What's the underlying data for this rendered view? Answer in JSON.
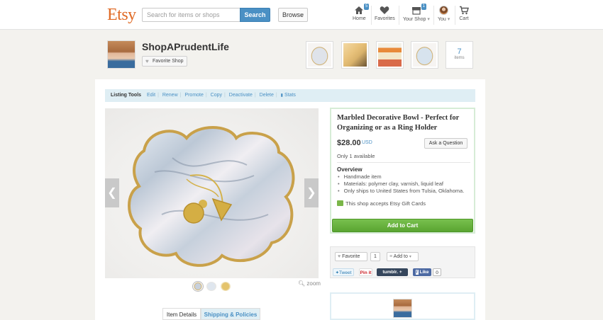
{
  "header": {
    "logo": "Etsy",
    "search_placeholder": "Search for items or shops",
    "search_button": "Search",
    "browse": "Browse",
    "nav": {
      "home": "Home",
      "home_badge": "5",
      "favorites": "Favorites",
      "your_shop": "Your Shop",
      "your_shop_badge": "1",
      "you": "You",
      "cart": "Cart"
    }
  },
  "shop": {
    "name": "ShopAPrudentLife",
    "favorite_button": "Favorite Shop",
    "items_count": "7",
    "items_label": "items"
  },
  "listing_tools": {
    "label": "Listing Tools",
    "links": [
      "Edit",
      "Renew",
      "Promote",
      "Copy",
      "Deactivate",
      "Delete",
      "Stats"
    ]
  },
  "item": {
    "title": "Marbled Decorative Bowl - Perfect for Organizing or as a Ring Holder",
    "price": "$28.00",
    "currency": "USD",
    "ask_button": "Ask a Question",
    "availability": "Only 1 available",
    "overview_title": "Overview",
    "overview": [
      "Handmade item",
      "Materials: polymer clay, varnish, liquid leaf",
      "Only ships to United States from Tulsia, Oklahoma."
    ],
    "gift_cards": "This shop accepts Etsy Gift Cards",
    "add_to_cart": "Add to Cart",
    "zoom": "zoom"
  },
  "actions": {
    "favorite": "Favorite",
    "favorite_count": "1",
    "add_to": "Add to",
    "tweet": "Tweet",
    "pin": "Pin it",
    "tumblr": "tumblr.",
    "like": "Like",
    "like_count": "0"
  },
  "tabs": [
    "Item Details",
    "Shipping & Policies"
  ],
  "colors": {
    "brand": "#e06a25",
    "accent": "#4a90c4",
    "cart_green": "#5aa531"
  }
}
